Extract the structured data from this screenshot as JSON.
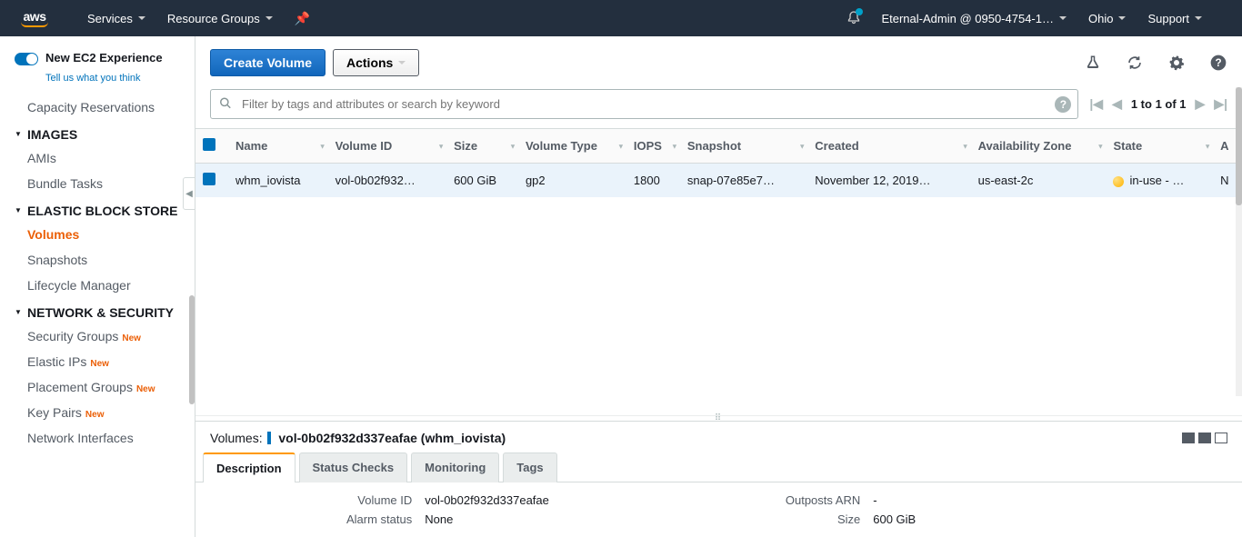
{
  "topnav": {
    "services": "Services",
    "resource_groups": "Resource Groups",
    "account": "Eternal-Admin @ 0950-4754-1…",
    "region": "Ohio",
    "support": "Support"
  },
  "sidebar": {
    "new_experience": "New EC2 Experience",
    "tell_us": "Tell us what you think",
    "items": {
      "capacity": "Capacity Reservations",
      "images_header": "Images",
      "amis": "AMIs",
      "bundle": "Bundle Tasks",
      "ebs_header": "Elastic Block Store",
      "volumes": "Volumes",
      "snapshots": "Snapshots",
      "lifecycle": "Lifecycle Manager",
      "net_header": "Network & Security",
      "sg": "Security Groups",
      "eip": "Elastic IPs",
      "pg": "Placement Groups",
      "kp": "Key Pairs",
      "ni": "Network Interfaces",
      "new_badge": "New"
    }
  },
  "toolbar": {
    "create": "Create Volume",
    "actions": "Actions"
  },
  "search": {
    "placeholder": "Filter by tags and attributes or search by keyword",
    "pager": "1 to 1 of 1"
  },
  "table": {
    "headers": {
      "name": "Name",
      "volid": "Volume ID",
      "size": "Size",
      "vtype": "Volume Type",
      "iops": "IOPS",
      "snapshot": "Snapshot",
      "created": "Created",
      "az": "Availability Zone",
      "state": "State",
      "a": "A"
    },
    "rows": [
      {
        "name": "whm_iovista",
        "volid": "vol-0b02f932…",
        "size": "600 GiB",
        "vtype": "gp2",
        "iops": "1800",
        "snapshot": "snap-07e85e7…",
        "created": "November 12, 2019…",
        "az": "us-east-2c",
        "state": "in-use - …",
        "a": "N"
      }
    ]
  },
  "detail": {
    "label": "Volumes:",
    "title": "vol-0b02f932d337eafae (whm_iovista)",
    "tabs": {
      "desc": "Description",
      "status": "Status Checks",
      "mon": "Monitoring",
      "tags": "Tags"
    },
    "kv_left": {
      "volid_k": "Volume ID",
      "volid_v": "vol-0b02f932d337eafae",
      "alarm_k": "Alarm status",
      "alarm_v": "None"
    },
    "kv_right": {
      "arn_k": "Outposts ARN",
      "arn_v": "-",
      "size_k": "Size",
      "size_v": "600 GiB"
    }
  }
}
